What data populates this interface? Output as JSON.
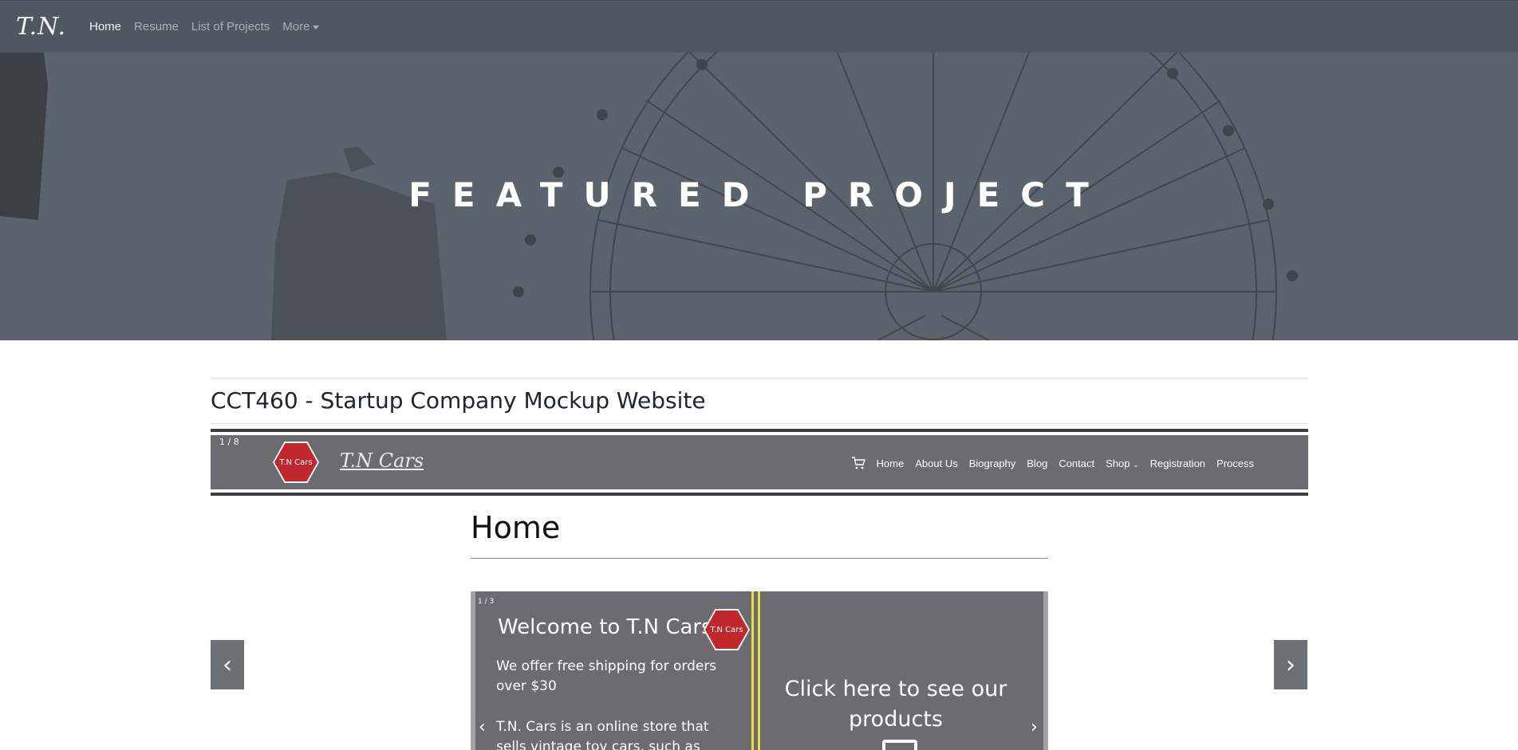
{
  "nav": {
    "brand": "T.N.",
    "items": [
      {
        "label": "Home",
        "active": true
      },
      {
        "label": "Resume",
        "active": false
      },
      {
        "label": "List of Projects",
        "active": false
      },
      {
        "label": "More",
        "active": false
      }
    ]
  },
  "hero": {
    "title": "FEATURED PROJECT"
  },
  "project": {
    "title": "CCT460 - Startup Company Mockup Website"
  },
  "slideshow": {
    "counter": "1 / 8",
    "prev": "‹",
    "next": "›",
    "mock": {
      "logo_text": "T.N Cars",
      "brand": "T.N Cars",
      "cart_icon": "shopping-cart-icon",
      "menu": [
        "Home",
        "About Us",
        "Biography",
        "Blog",
        "Contact",
        "Shop",
        "Registration",
        "Process"
      ],
      "page_heading": "Home",
      "carousel": {
        "counter": "1 / 3",
        "welcome": "Welcome to T.N Cars",
        "badge": "T.N Cars",
        "shipping": "We offer free shipping for orders over $30",
        "about": "T.N. Cars is an online store that sells vintage toy cars, such as",
        "cta": "Click here to see our products",
        "prev": "‹",
        "next": "›"
      }
    }
  },
  "colors": {
    "navbar": "#4f5861",
    "hero": "#5b636c",
    "mock_nav": "#6b6b70",
    "accent_red": "#c0282d",
    "accent_yellow": "#e8e03a"
  }
}
